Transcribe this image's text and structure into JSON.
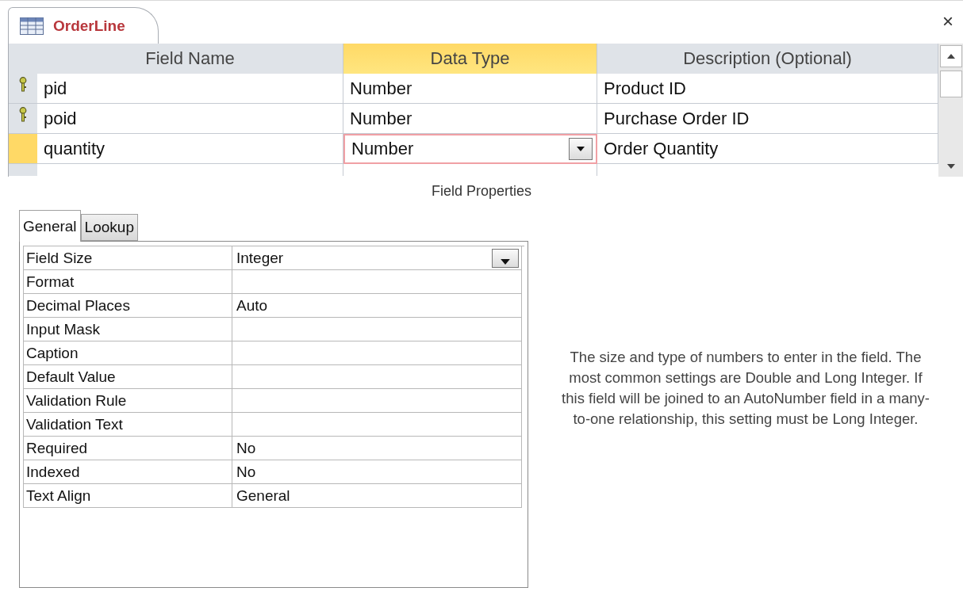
{
  "document_tab": {
    "title": "OrderLine",
    "close": "×"
  },
  "design_grid": {
    "columns": [
      {
        "label": "Field Name",
        "selected": false
      },
      {
        "label": "Data Type",
        "selected": true
      },
      {
        "label": "Description (Optional)",
        "selected": false
      }
    ],
    "rows": [
      {
        "field_name": "pid",
        "data_type": "Number",
        "description": "Product ID",
        "primary_key": true,
        "selected": false
      },
      {
        "field_name": "poid",
        "data_type": "Number",
        "description": "Purchase Order ID",
        "primary_key": true,
        "selected": false
      },
      {
        "field_name": "quantity",
        "data_type": "Number",
        "description": "Order Quantity",
        "primary_key": false,
        "selected": true
      }
    ]
  },
  "field_properties": {
    "title": "Field Properties",
    "tabs": [
      {
        "label": "General",
        "selected": true
      },
      {
        "label": "Lookup",
        "selected": false
      }
    ],
    "properties": [
      {
        "name": "Field Size",
        "value": "Integer",
        "dropdown": true
      },
      {
        "name": "Format",
        "dropdown": false
      },
      {
        "name": "Decimal Places",
        "value": "Auto",
        "dropdown": false
      },
      {
        "name": "Input Mask",
        "dropdown": false
      },
      {
        "name": "Caption",
        "dropdown": false
      },
      {
        "name": "Default Value",
        "dropdown": false
      },
      {
        "name": "Validation Rule",
        "dropdown": false
      },
      {
        "name": "Validation Text",
        "dropdown": false
      },
      {
        "name": "Required",
        "value": "No",
        "dropdown": false
      },
      {
        "name": "Indexed",
        "value": "No",
        "dropdown": false
      },
      {
        "name": "Text Align",
        "value": "General",
        "dropdown": false
      }
    ],
    "help_text": "The size and type of numbers to enter in the field. The most common settings are Double and Long Integer. If this field will be joined to an AutoNumber field in a many-to-one relationship, this setting must be Long Integer."
  }
}
